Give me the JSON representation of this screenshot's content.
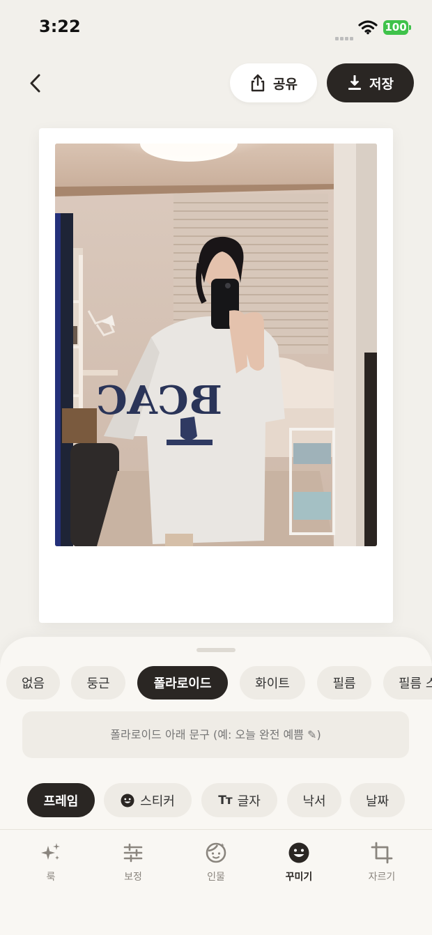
{
  "status": {
    "time": "3:22",
    "battery": "100"
  },
  "header": {
    "share_label": "공유",
    "save_label": "저장"
  },
  "frame_styles": [
    {
      "label": "없음",
      "active": false
    },
    {
      "label": "둥근",
      "active": false
    },
    {
      "label": "폴라로이드",
      "active": true
    },
    {
      "label": "화이트",
      "active": false
    },
    {
      "label": "필름",
      "active": false
    },
    {
      "label": "필름 스",
      "active": false
    }
  ],
  "caption": {
    "placeholder": "폴라로이드 아래 문구 (예: 오늘 완전 예쁨 ✎)"
  },
  "tools": [
    {
      "label": "프레임",
      "active": true
    },
    {
      "label": "스티커",
      "active": false,
      "icon": "smile-icon"
    },
    {
      "label": "글자",
      "active": false,
      "icon": "text-icon",
      "glyph": "Tт"
    },
    {
      "label": "낙서",
      "active": false
    },
    {
      "label": "날짜",
      "active": false
    }
  ],
  "bottom_nav": [
    {
      "label": "룩",
      "icon": "sparkle-icon",
      "active": false
    },
    {
      "label": "보정",
      "icon": "sliders-icon",
      "active": false
    },
    {
      "label": "인물",
      "icon": "face-icon",
      "active": false
    },
    {
      "label": "꾸미기",
      "icon": "smile-icon",
      "active": true
    },
    {
      "label": "자르기",
      "icon": "crop-icon",
      "active": false
    }
  ],
  "colors": {
    "accent": "#2a2623",
    "background": "#f2f0eb",
    "sheet": "#f9f7f3",
    "battery": "#3fc24a"
  }
}
